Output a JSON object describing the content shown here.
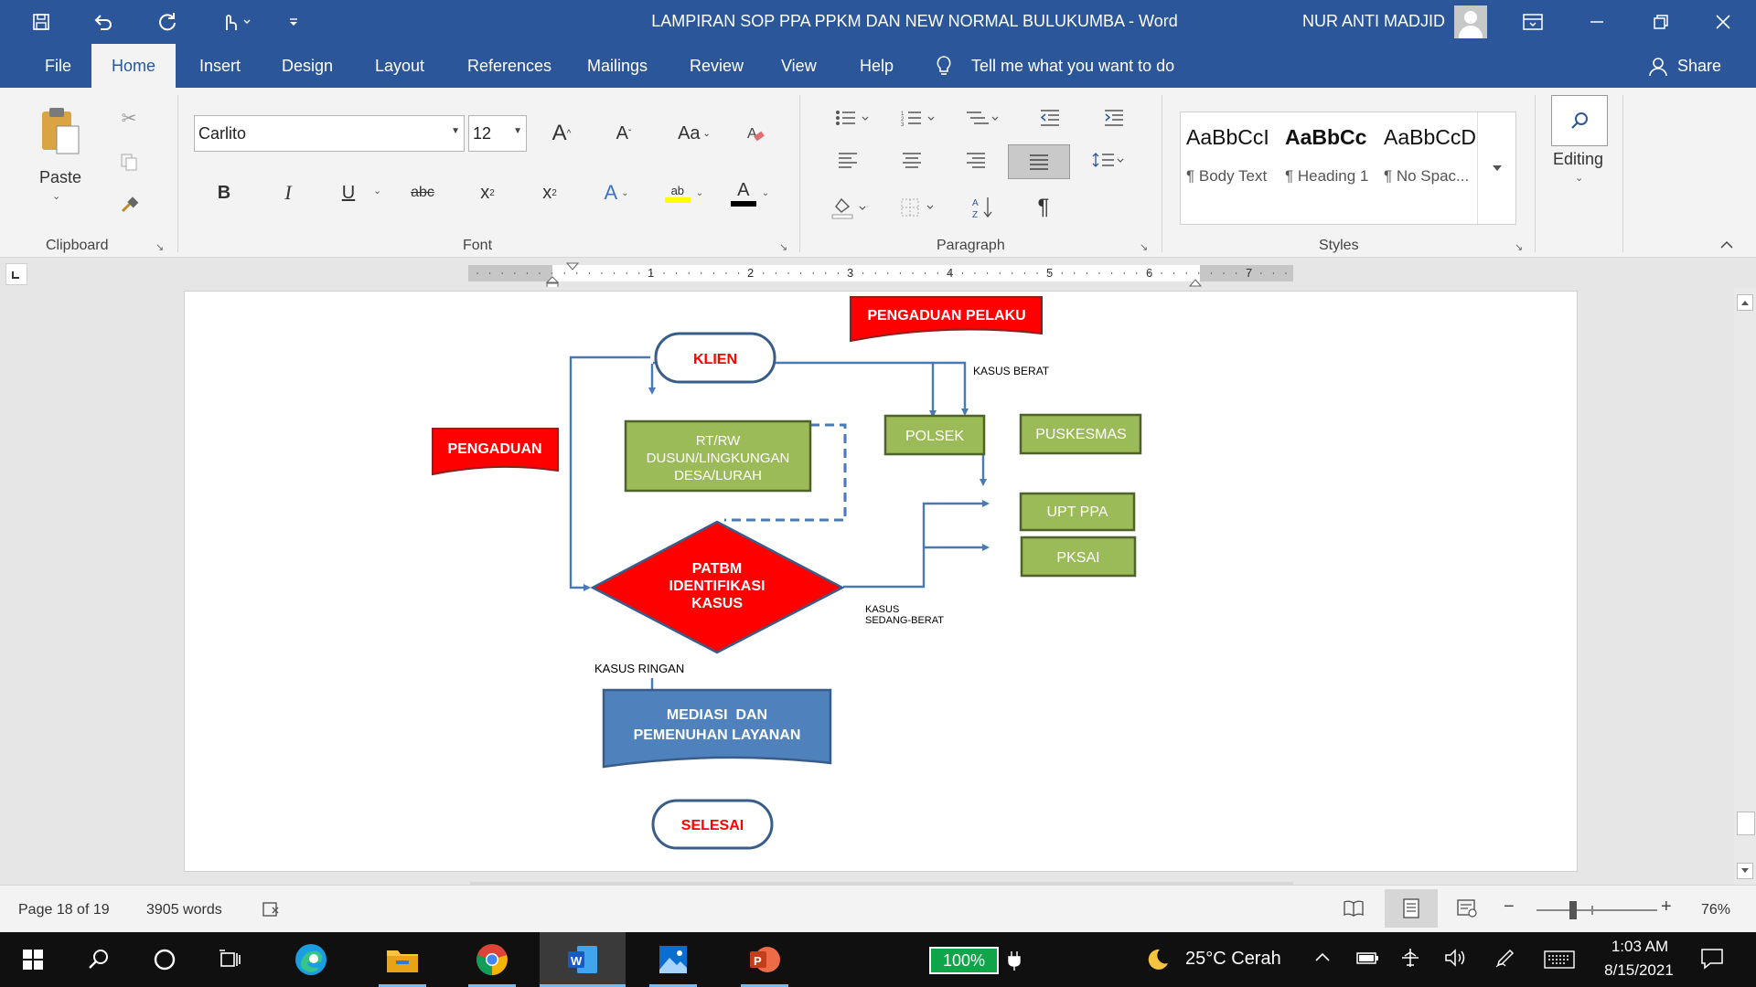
{
  "window": {
    "document_title": "LAMPIRAN SOP PPA PPKM DAN NEW NORMAL BULUKUMBA  -  Word",
    "user_name": "NUR ANTI MADJID"
  },
  "tabs": [
    "File",
    "Home",
    "Insert",
    "Design",
    "Layout",
    "References",
    "Mailings",
    "Review",
    "View",
    "Help"
  ],
  "tell_me": "Tell me what you want to do",
  "share_label": "Share",
  "ribbon": {
    "clipboard": {
      "paste_label": "Paste",
      "group_label": "Clipboard"
    },
    "font": {
      "font_name": "Carlito",
      "font_size": "12",
      "grow_label": "A",
      "shrink_label": "A",
      "case_label": "Aa",
      "bold_label": "B",
      "italic_label": "I",
      "underline_label": "U",
      "strike_label": "abc",
      "subscript_label": "x",
      "superscript_label": "x",
      "text_effects_label": "A",
      "highlight_label": "ab",
      "font_color_label": "A",
      "group_label": "Font"
    },
    "paragraph": {
      "group_label": "Paragraph"
    },
    "styles": {
      "items": [
        {
          "sample": "AaBbCcI",
          "name": "¶ Body Text"
        },
        {
          "sample": "AaBbCc",
          "name": "¶ Heading 1"
        },
        {
          "sample": "AaBbCcD",
          "name": "¶ No Spac..."
        }
      ],
      "group_label": "Styles"
    },
    "editing_label": "Editing"
  },
  "ruler_numbers": [
    "1",
    "2",
    "3",
    "4",
    "5",
    "6",
    "7"
  ],
  "diagram": {
    "pengaduan_pelaku": "PENGADUAN PELAKU",
    "pengaduan": "PENGADUAN",
    "klien": "KLIEN",
    "rtrw_line1": "RT/RW",
    "rtrw_line2": "DUSUN/LINGKUNGAN",
    "rtrw_line3": "DESA/LURAH",
    "polsek": "POLSEK",
    "puskesmas": "PUSKESMAS",
    "kasus_berat": "KASUS BERAT",
    "upt_ppa": "UPT PPA",
    "pksai": "PKSAI",
    "patbm_line1": "PATBM",
    "patbm_line2": "IDENTIFIKASI",
    "patbm_line3": "KASUS",
    "kasus_sedang_line1": "KASUS",
    "kasus_sedang_line2": "SEDANG-BERAT",
    "kasus_ringan": "KASUS RINGAN",
    "mediasi_line1": "MEDIASI  DAN",
    "mediasi_line2": "PEMENUHAN LAYANAN",
    "selesai": "SELESAI",
    "colors": {
      "red": "#ff0000",
      "green": "#9bbb59",
      "green_border": "#4f6228",
      "blue": "#4f81bd",
      "blue_border": "#385d8a",
      "line": "#4a7ab5"
    }
  },
  "status": {
    "page": "Page 18 of 19",
    "words": "3905 words",
    "zoom": "76%"
  },
  "taskbar": {
    "battery": "100%",
    "weather": "25°C  Cerah",
    "time": "1:03 AM",
    "date": "8/15/2021"
  }
}
